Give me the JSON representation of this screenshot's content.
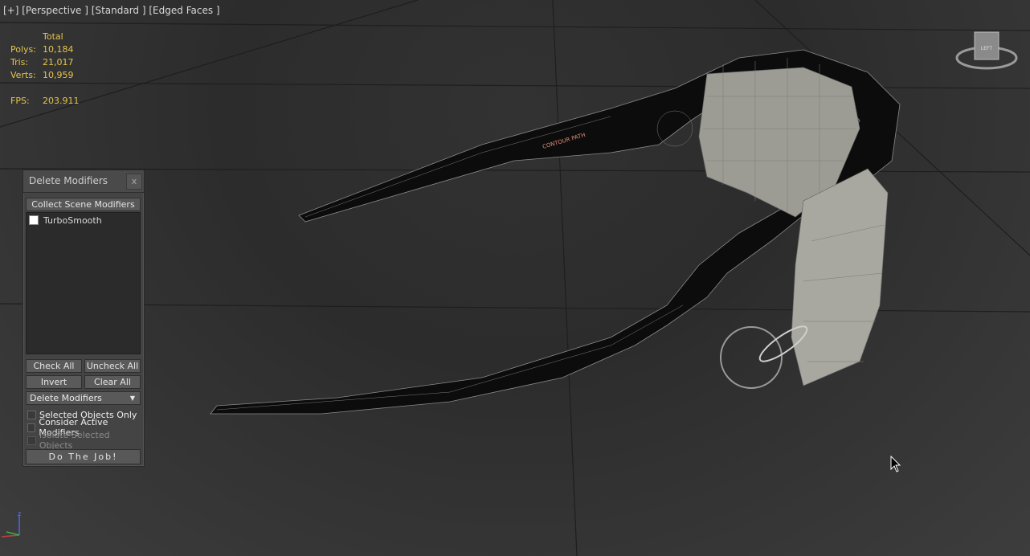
{
  "viewport": {
    "label_parts": [
      "[+]",
      "[Perspective ]",
      "[Standard ]",
      "[Edged Faces ]"
    ],
    "nav_cube_face": "LEFT"
  },
  "stats": {
    "header": "Total",
    "polys_label": "Polys:",
    "polys": "10,184",
    "tris_label": "Tris:",
    "tris": "21,017",
    "verts_label": "Verts:",
    "verts": "10,959",
    "fps_label": "FPS:",
    "fps": "203.911",
    "color": "#e6c44a"
  },
  "panel": {
    "title": "Delete Modifiers",
    "close_label": "x",
    "collect_button": "Collect Scene Modifiers",
    "modifiers": [
      {
        "label": "TurboSmooth",
        "checked": false
      }
    ],
    "check_all": "Check All",
    "uncheck_all": "Uncheck All",
    "invert": "Invert",
    "clear_all": "Clear All",
    "mode_select": "Delete Modifiers",
    "option_selected_only": "Selected Objects Only",
    "option_consider_active": "Consider Active Modifiers",
    "option_isolate": "Isolate Selected Objects",
    "do_job": "Do The Job!"
  },
  "icons": {
    "cursor": "mouse-pointer-icon",
    "axis": "axis-tripod-icon",
    "navcube": "view-cube-icon",
    "dropdown": "chevron-down-icon"
  }
}
